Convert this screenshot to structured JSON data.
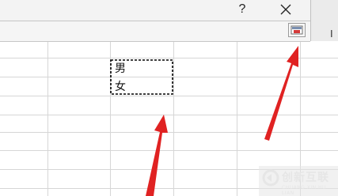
{
  "dialog": {
    "help_label": "?",
    "right_edge_glyph": "I",
    "icons": {
      "close": "close-icon",
      "range_selector": "collapse-dialog-icon"
    }
  },
  "cells": {
    "values": [
      "男",
      "女"
    ]
  },
  "watermark": {
    "title": "创新互联",
    "subtitle": "CHUANG XIN HU LIAN"
  },
  "colors": {
    "gridline": "#d4d4d4",
    "annotation_arrow": "#e02020",
    "selection_border": "#000000"
  }
}
